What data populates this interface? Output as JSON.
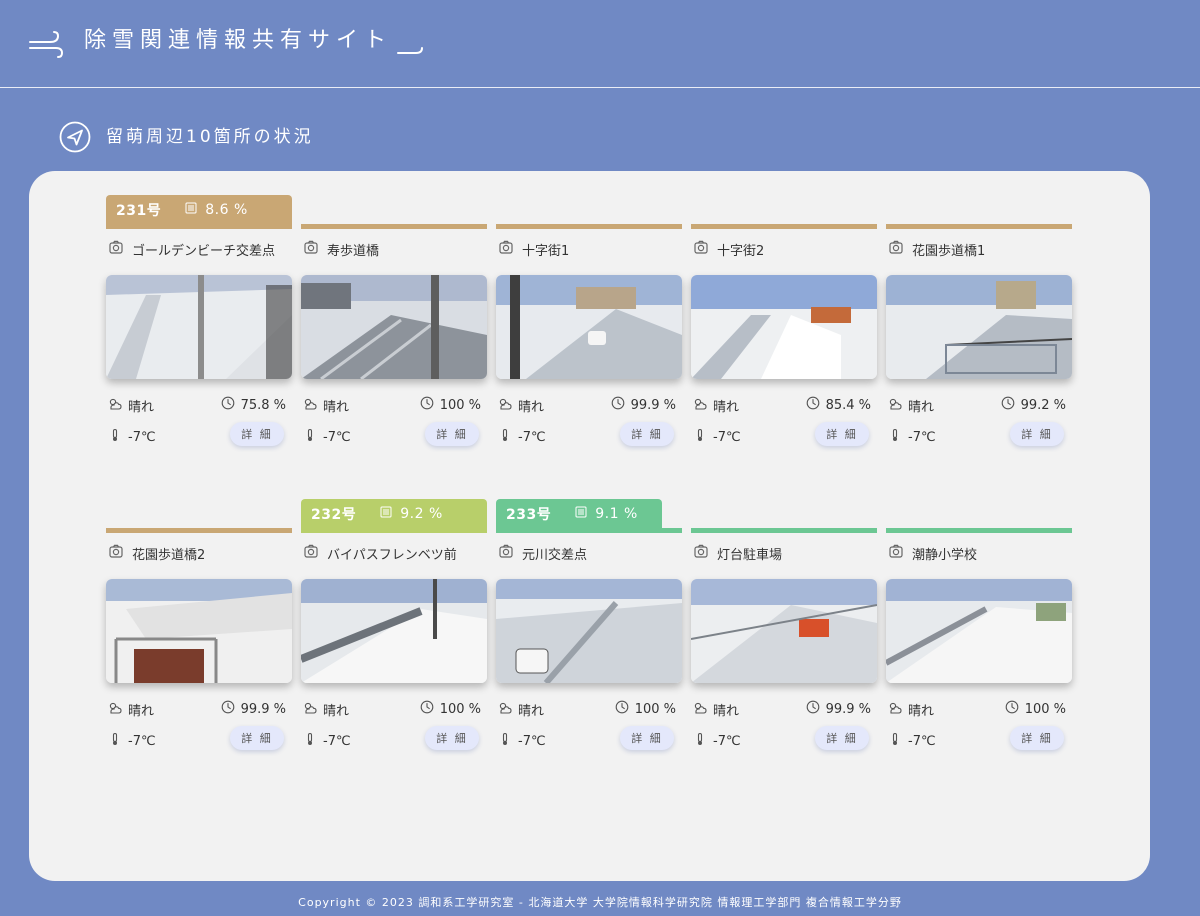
{
  "header": {
    "title": "除雪関連情報共有サイト"
  },
  "section": {
    "title": "留萌周辺10箇所の状況"
  },
  "colors": {
    "route231": "#c9a774",
    "route232": "#b8cf6a",
    "route233": "#6cc793",
    "background": "#7089c4",
    "panel": "#f2f2f2"
  },
  "cards": [
    {
      "name": "ゴールデンビーチ交差点",
      "weather": "晴れ",
      "percent": "75.8 %",
      "temp": "-7℃",
      "detail": "詳 細",
      "route": "231号",
      "route_pct": "8.6 %"
    },
    {
      "name": "寿歩道橋",
      "weather": "晴れ",
      "percent": "100 %",
      "temp": "-7℃",
      "detail": "詳 細"
    },
    {
      "name": "十字街1",
      "weather": "晴れ",
      "percent": "99.9 %",
      "temp": "-7℃",
      "detail": "詳 細"
    },
    {
      "name": "十字街2",
      "weather": "晴れ",
      "percent": "85.4 %",
      "temp": "-7℃",
      "detail": "詳 細"
    },
    {
      "name": "花園歩道橋1",
      "weather": "晴れ",
      "percent": "99.2 %",
      "temp": "-7℃",
      "detail": "詳 細"
    },
    {
      "name": "花園歩道橋2",
      "weather": "晴れ",
      "percent": "99.9 %",
      "temp": "-7℃",
      "detail": "詳 細"
    },
    {
      "name": "バイパスフレンベツ前",
      "weather": "晴れ",
      "percent": "100 %",
      "temp": "-7℃",
      "detail": "詳 細",
      "route": "232号",
      "route_pct": "9.2 %"
    },
    {
      "name": "元川交差点",
      "weather": "晴れ",
      "percent": "100 %",
      "temp": "-7℃",
      "detail": "詳 細",
      "route": "233号",
      "route_pct": "9.1 %"
    },
    {
      "name": "灯台駐車場",
      "weather": "晴れ",
      "percent": "99.9 %",
      "temp": "-7℃",
      "detail": "詳 細"
    },
    {
      "name": "潮静小学校",
      "weather": "晴れ",
      "percent": "100 %",
      "temp": "-7℃",
      "detail": "詳 細"
    }
  ],
  "footer": {
    "copyright": "Copyright © 2023 調和系工学研究室 - 北海道大学 大学院情報科学研究院 情報理工学部門 複合情報工学分野"
  }
}
